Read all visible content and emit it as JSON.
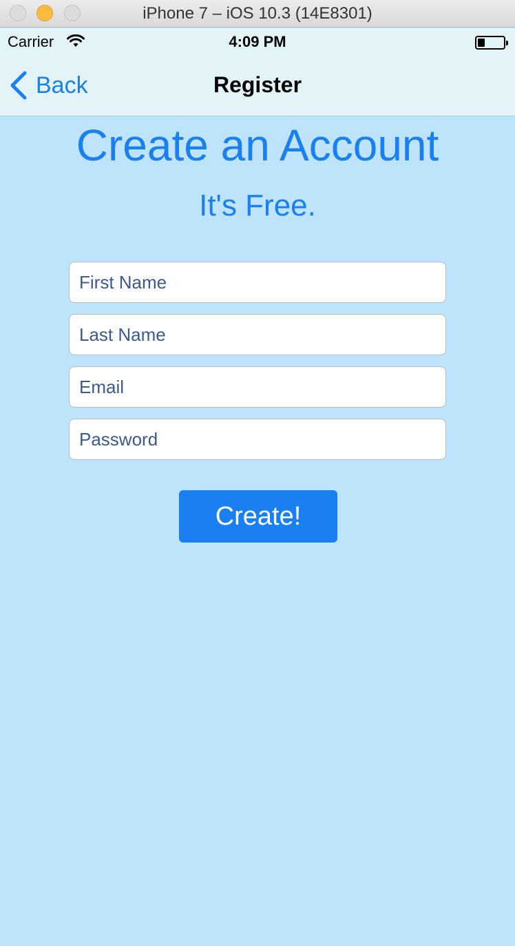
{
  "window": {
    "title": "iPhone 7 – iOS 10.3 (14E8301)"
  },
  "status_bar": {
    "carrier": "Carrier",
    "time": "4:09 PM"
  },
  "nav": {
    "back_label": "Back",
    "title": "Register"
  },
  "main": {
    "headline": "Create an Account",
    "subheadline": "It's Free.",
    "fields": {
      "first_name": {
        "placeholder": "First Name",
        "value": ""
      },
      "last_name": {
        "placeholder": "Last Name",
        "value": ""
      },
      "email": {
        "placeholder": "Email",
        "value": ""
      },
      "password": {
        "placeholder": "Password",
        "value": ""
      }
    },
    "create_label": "Create!"
  },
  "colors": {
    "accent": "#1a7ff0",
    "background": "#bde4fb",
    "bar": "#e3f4f9"
  },
  "icons": [
    "close-icon",
    "minimize-icon",
    "maximize-icon",
    "wifi-icon",
    "battery-icon",
    "chevron-left-icon"
  ]
}
